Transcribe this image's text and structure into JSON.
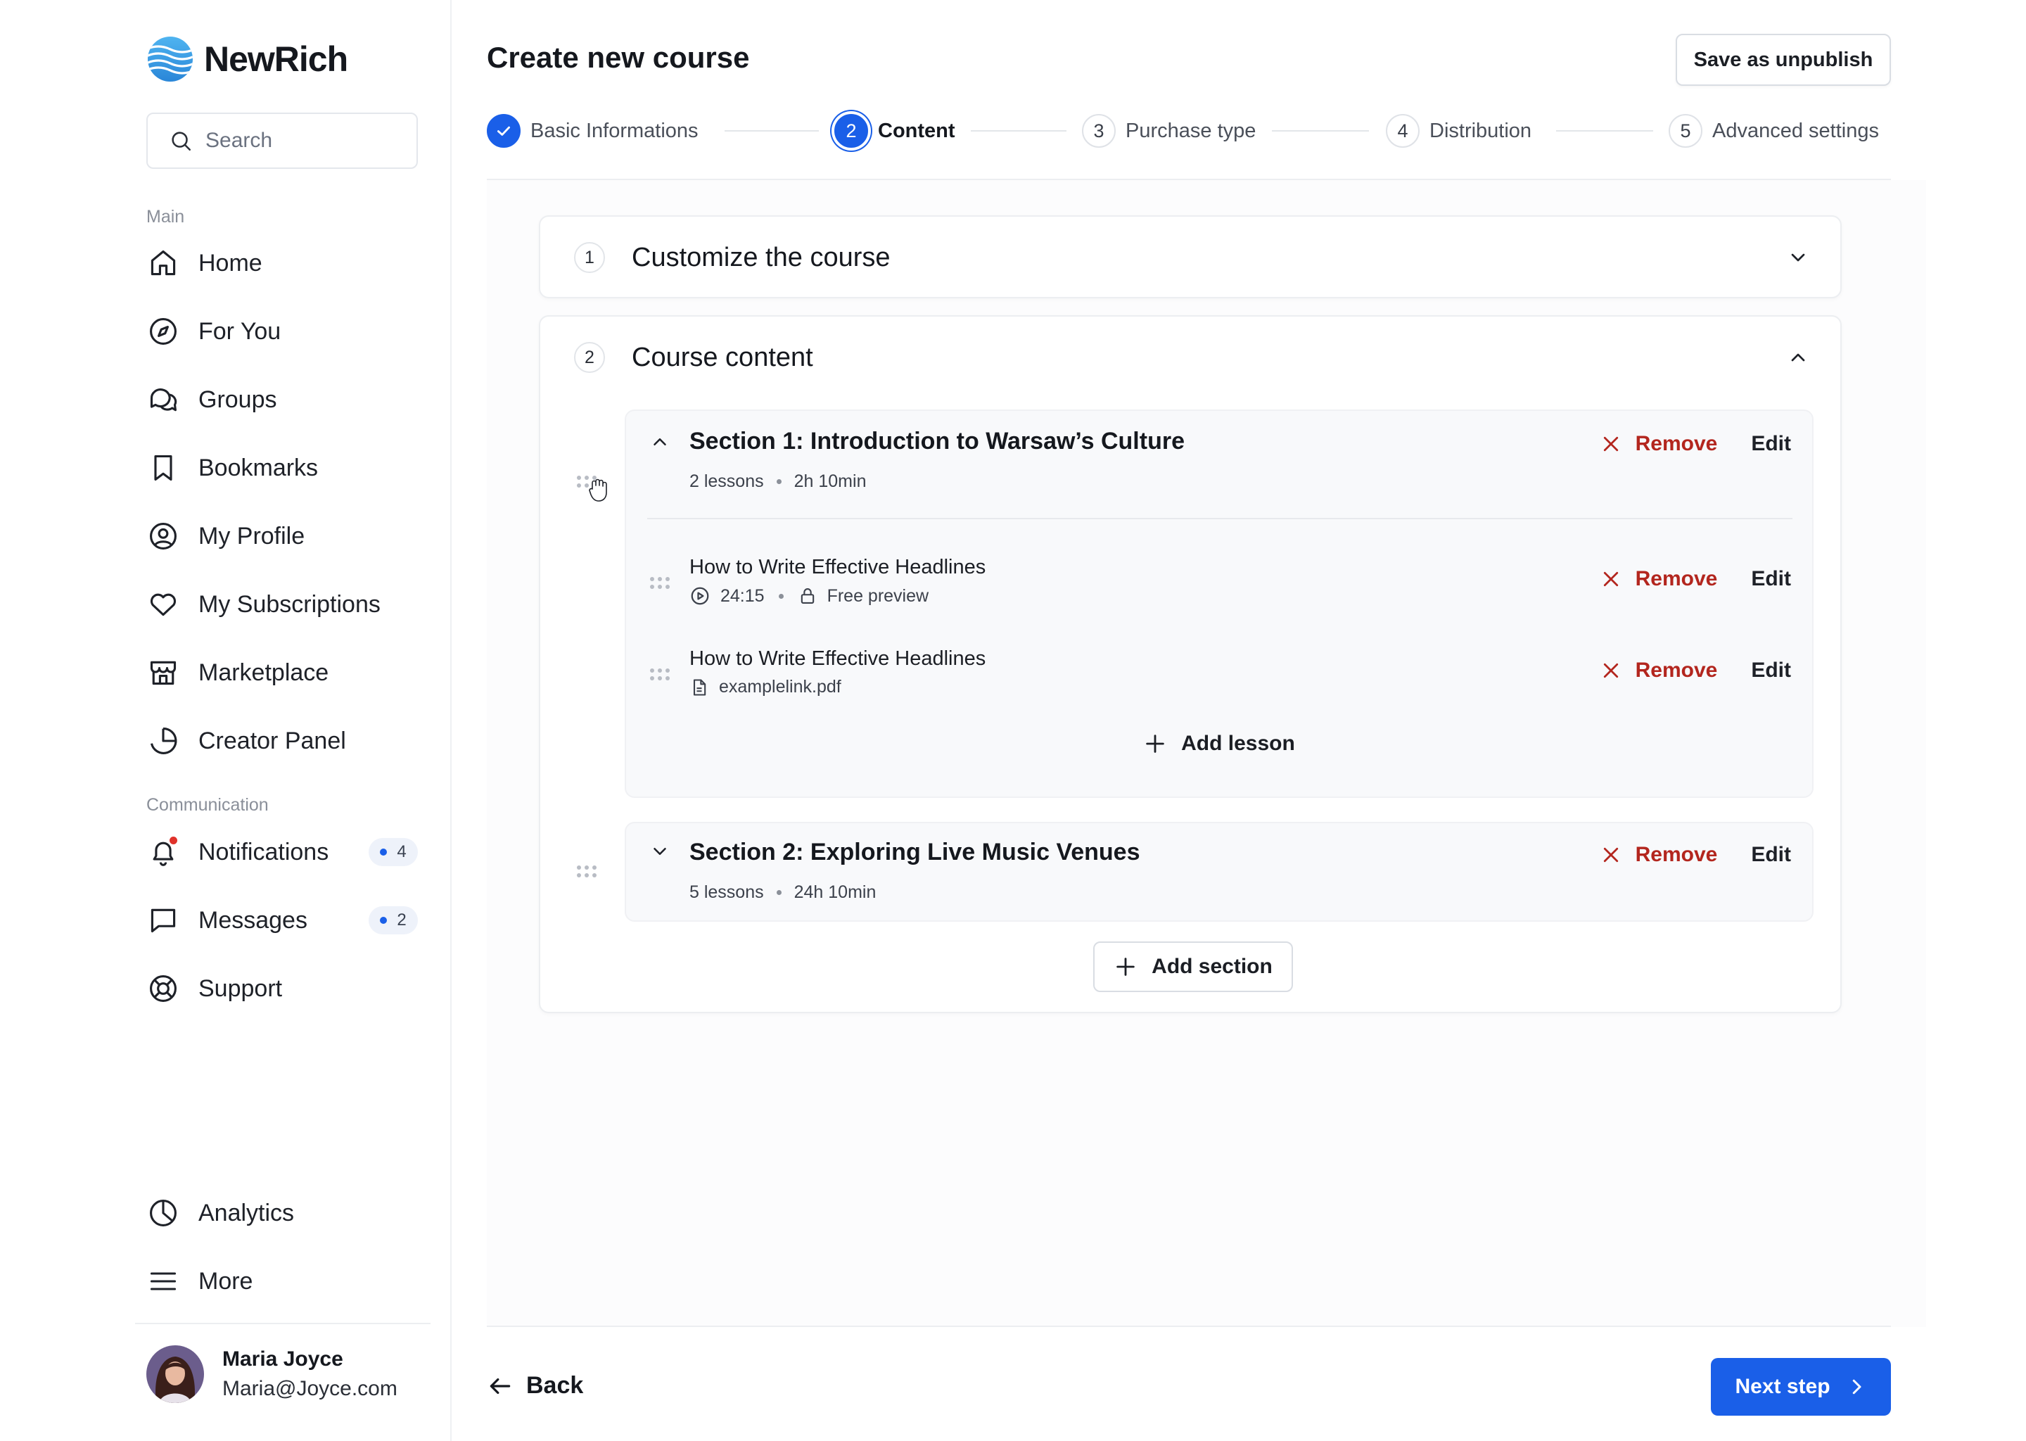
{
  "app": {
    "name": "NewRich"
  },
  "search": {
    "placeholder": "Search"
  },
  "sidebar": {
    "main_label": "Main",
    "main_items": [
      {
        "label": "Home",
        "icon": "home-icon"
      },
      {
        "label": "For You",
        "icon": "compass-icon"
      },
      {
        "label": "Groups",
        "icon": "chat-bubbles-icon"
      },
      {
        "label": "Bookmarks",
        "icon": "bookmark-icon"
      },
      {
        "label": "My Profile",
        "icon": "user-circle-icon"
      },
      {
        "label": "My Subscriptions",
        "icon": "heart-icon"
      },
      {
        "label": "Marketplace",
        "icon": "store-icon"
      },
      {
        "label": "Creator Panel",
        "icon": "pie-chart-icon"
      }
    ],
    "communication_label": "Communication",
    "communication_items": [
      {
        "label": "Notifications",
        "icon": "bell-icon",
        "badge": "4"
      },
      {
        "label": "Messages",
        "icon": "message-icon",
        "badge": "2"
      },
      {
        "label": "Support",
        "icon": "lifebuoy-icon"
      }
    ],
    "bottom_items": [
      {
        "label": "Analytics",
        "icon": "analytics-icon"
      },
      {
        "label": "More",
        "icon": "menu-icon"
      }
    ],
    "user": {
      "name": "Maria Joyce",
      "email": "Maria@Joyce.com"
    }
  },
  "header": {
    "title": "Create new course",
    "save_label": "Save as unpublish"
  },
  "stepper": {
    "steps": [
      {
        "number": "1",
        "label": "Basic Informations",
        "state": "done"
      },
      {
        "number": "2",
        "label": "Content",
        "state": "active"
      },
      {
        "number": "3",
        "label": "Purchase type",
        "state": "pending"
      },
      {
        "number": "4",
        "label": "Distribution",
        "state": "pending"
      },
      {
        "number": "5",
        "label": "Advanced settings",
        "state": "pending"
      }
    ]
  },
  "cards": {
    "customize": {
      "number": "1",
      "title": "Customize the course"
    },
    "content": {
      "number": "2",
      "title": "Course content"
    }
  },
  "sections": [
    {
      "title": "Section 1: Introduction to Warsaw’s Culture",
      "lessons_count": "2 lessons",
      "duration": "2h 10min",
      "expanded": true,
      "lessons": [
        {
          "title": "How to Write Effective Headlines",
          "duration": "24:15",
          "tag": "Free preview"
        },
        {
          "title": "How to Write Effective Headlines",
          "file": "examplelink.pdf"
        }
      ],
      "add_lesson_label": "Add lesson"
    },
    {
      "title": "Section 2: Exploring Live Music Venues",
      "lessons_count": "5 lessons",
      "duration": "24h 10min",
      "expanded": false
    }
  ],
  "actions": {
    "remove_label": "Remove",
    "edit_label": "Edit"
  },
  "add_section_label": "Add section",
  "footer": {
    "back_label": "Back",
    "next_label": "Next step"
  },
  "colors": {
    "accent": "#1a5fe8",
    "danger": "#b3261e",
    "notification_dot": "#e0322b"
  }
}
